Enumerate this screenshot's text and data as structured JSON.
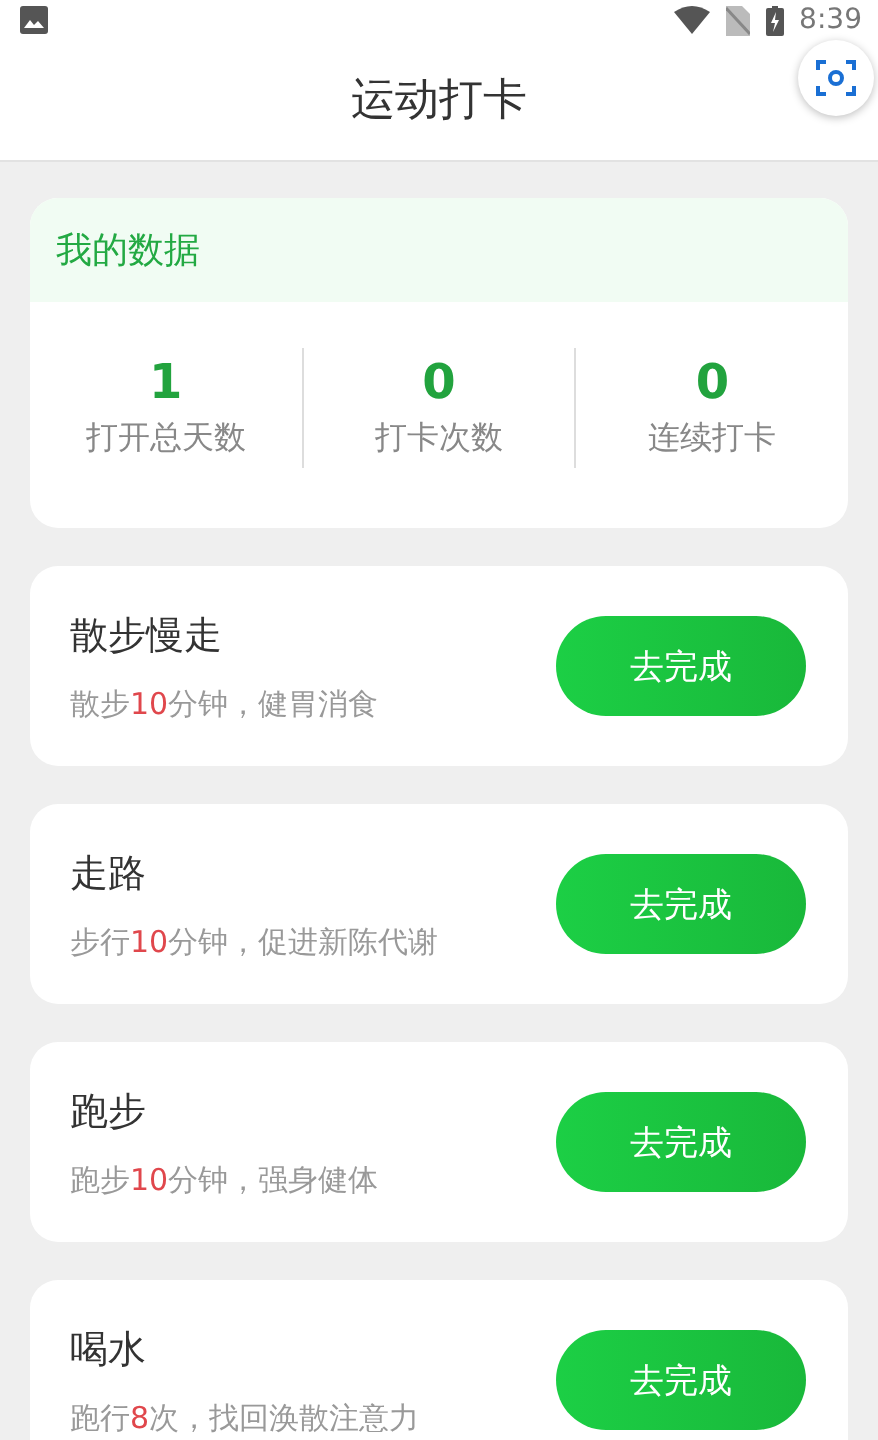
{
  "status_bar": {
    "time": "8:39"
  },
  "title": "运动打卡",
  "my_data": {
    "title": "我的数据",
    "stats": [
      {
        "value": "1",
        "label": "打开总天数"
      },
      {
        "value": "0",
        "label": "打卡次数"
      },
      {
        "value": "0",
        "label": "连续打卡"
      }
    ]
  },
  "tasks": [
    {
      "name": "散步慢走",
      "desc_before": "散步",
      "desc_number": "10",
      "desc_after": "分钟，健胃消食",
      "button": "去完成"
    },
    {
      "name": "走路",
      "desc_before": "步行",
      "desc_number": "10",
      "desc_after": "分钟，促进新陈代谢",
      "button": "去完成"
    },
    {
      "name": "跑步",
      "desc_before": "跑步",
      "desc_number": "10",
      "desc_after": "分钟，强身健体",
      "button": "去完成"
    },
    {
      "name": "喝水",
      "desc_before": "跑行",
      "desc_number": "8",
      "desc_after": "次，找回涣散注意力",
      "button": "去完成"
    }
  ]
}
